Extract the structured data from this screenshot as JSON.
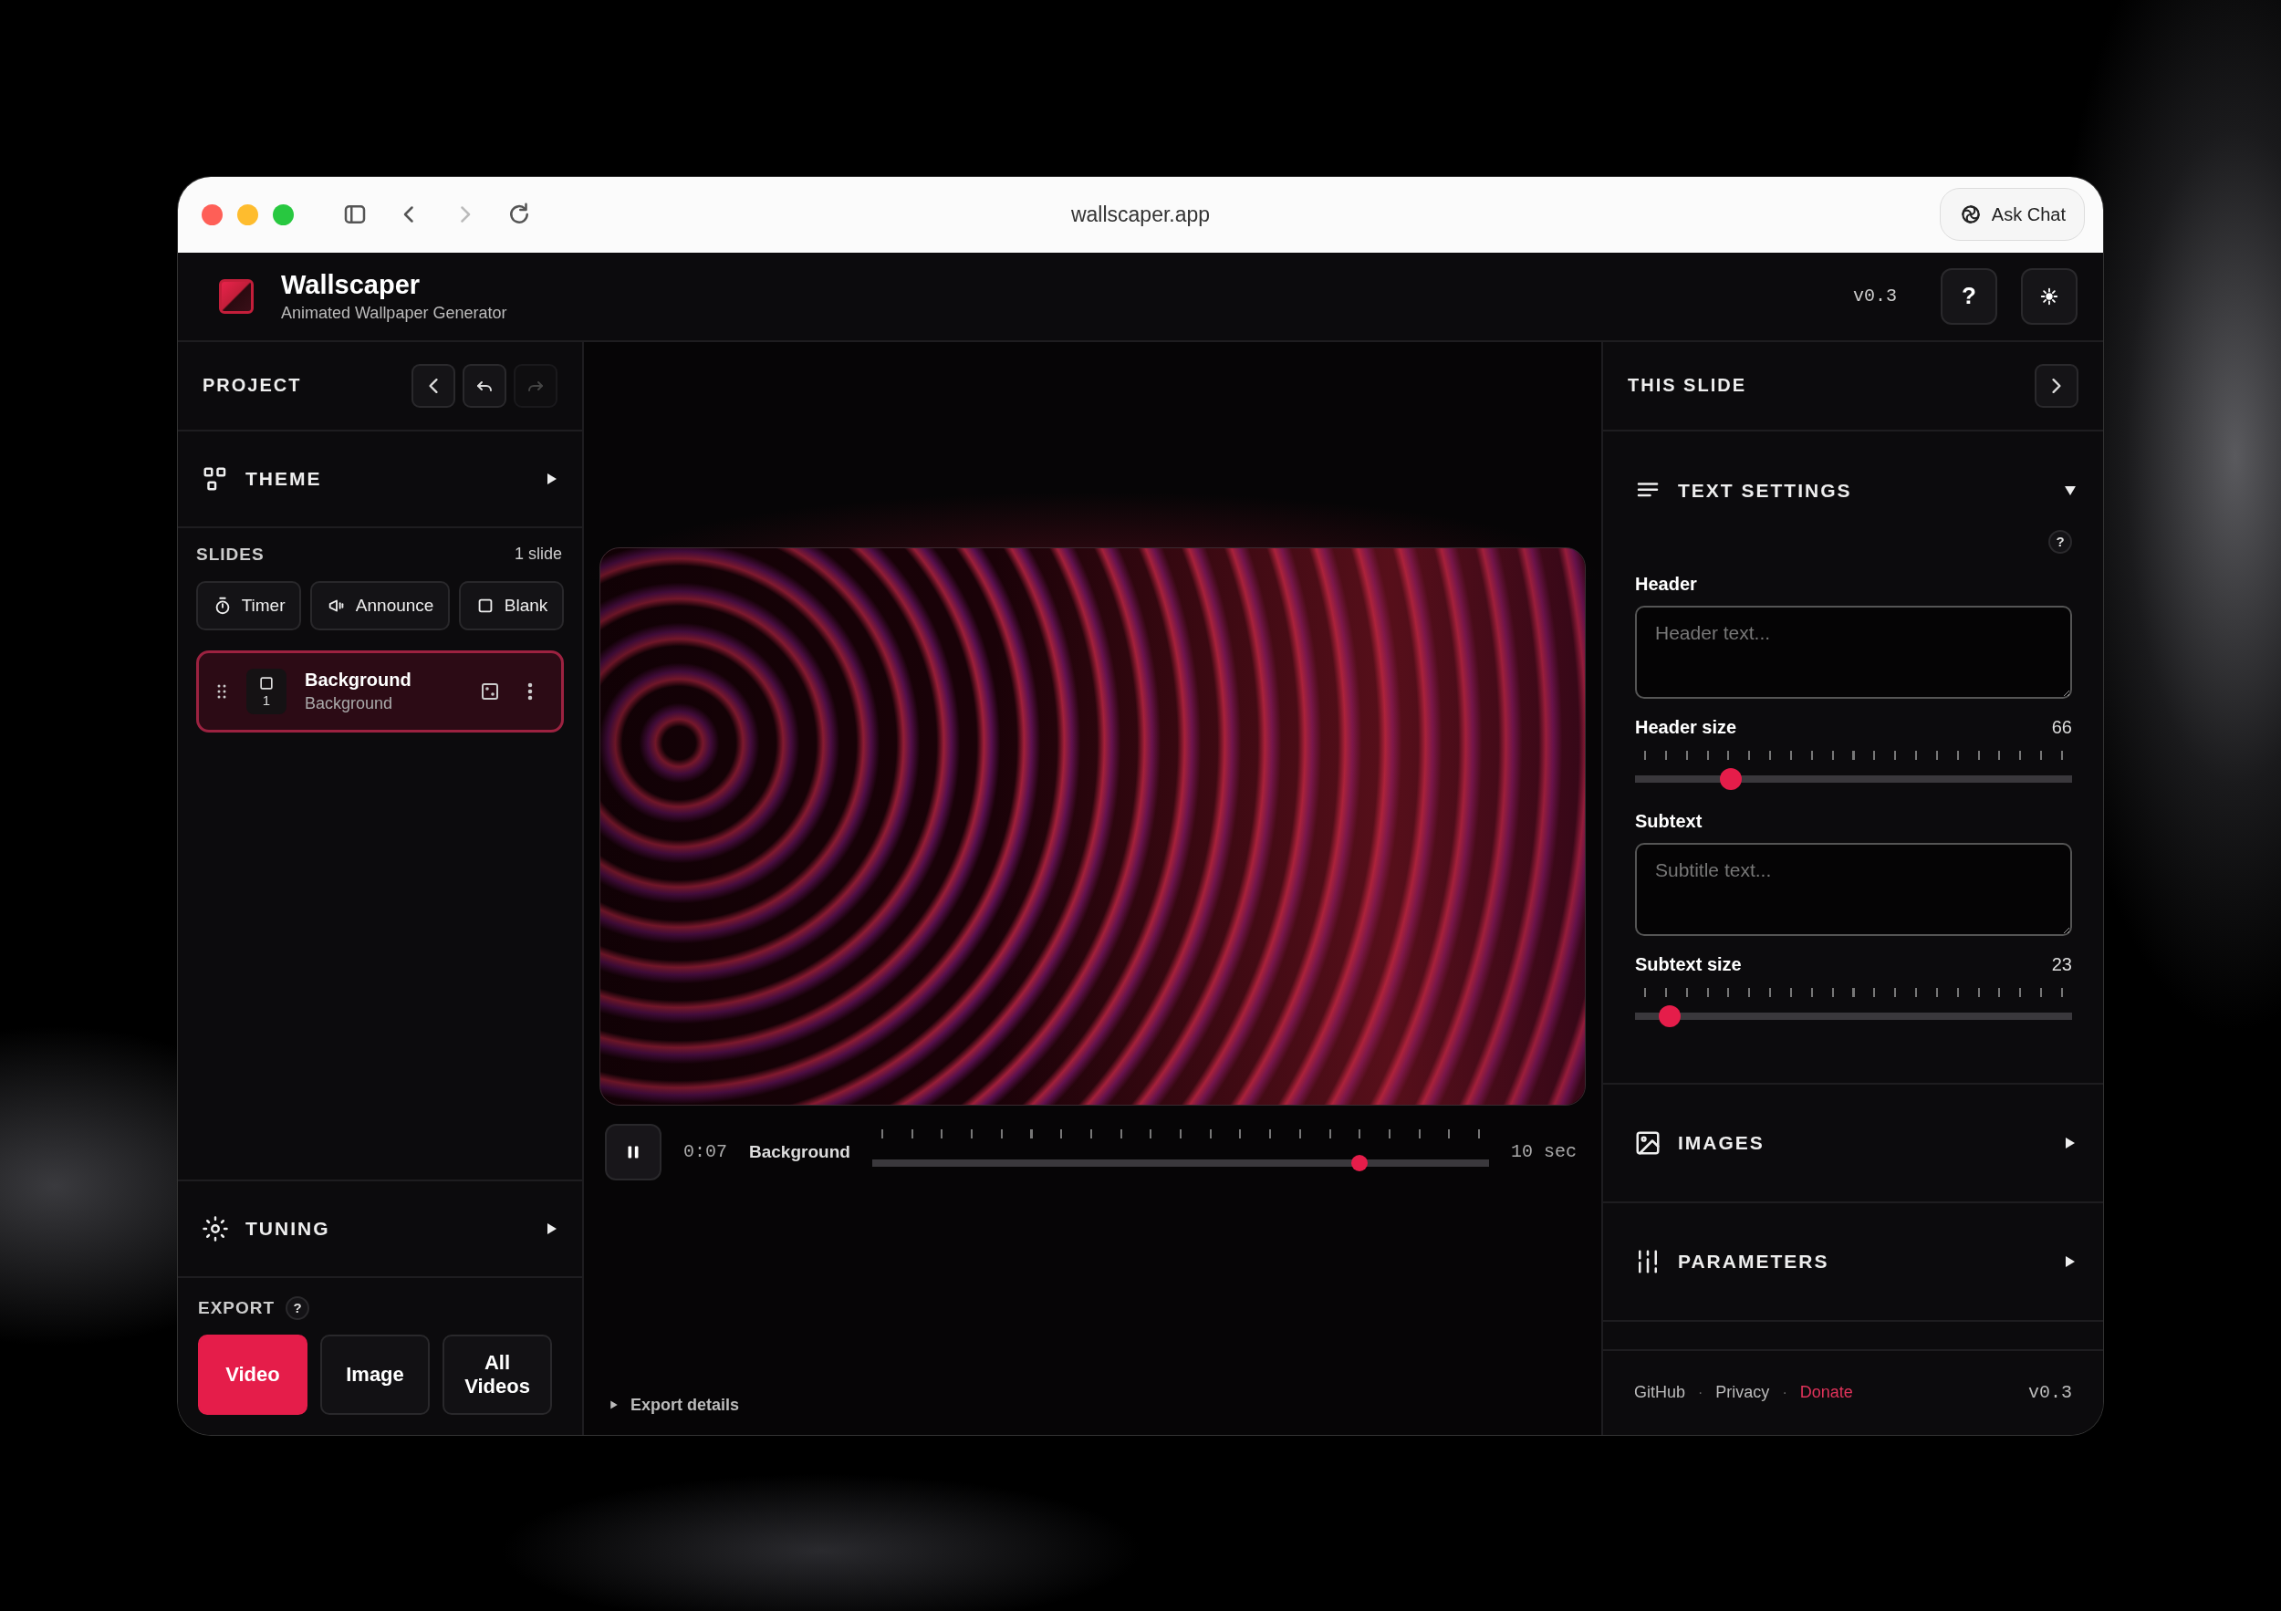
{
  "browser": {
    "url": "wallscaper.app",
    "ask_chat": "Ask Chat"
  },
  "app": {
    "title": "Wallscaper",
    "subtitle": "Animated Wallpaper Generator",
    "version": "v0.3",
    "help": "?"
  },
  "left_panel": {
    "title": "PROJECT",
    "nav_buttons": [
      {
        "kind": "back",
        "disabled": false
      },
      {
        "kind": "undo",
        "disabled": false
      },
      {
        "kind": "redo",
        "disabled": true
      }
    ],
    "theme": {
      "label": "THEME",
      "expanded": false
    },
    "slides": {
      "title": "SLIDES",
      "count": "1 slide",
      "add_buttons": [
        {
          "label": "Timer",
          "kind": "timer"
        },
        {
          "label": "Announce",
          "kind": "announce"
        },
        {
          "label": "Blank",
          "kind": "blank"
        }
      ],
      "items": [
        {
          "number": "1",
          "title": "Background",
          "subtitle": "Background",
          "selected": true
        }
      ]
    },
    "tuning": {
      "label": "TUNING",
      "expanded": false
    },
    "export": {
      "title": "EXPORT",
      "help": "?",
      "buttons": [
        {
          "label": "Video",
          "selected": true
        },
        {
          "label": "Image",
          "selected": false
        },
        {
          "label": "All Videos",
          "selected": false
        }
      ]
    }
  },
  "player": {
    "playing": true,
    "time": "0:07",
    "slide": "Background",
    "level": 0.79,
    "duration": "10 sec",
    "export_details": "Export details"
  },
  "right_panel": {
    "title": "THIS SLIDE",
    "sections": [
      {
        "kind": "text",
        "label": "TEXT SETTINGS",
        "expanded": true,
        "help": "?",
        "fields": [
          {
            "kind": "textarea",
            "label": "Header",
            "placeholder": "Header text..."
          },
          {
            "kind": "slider",
            "label": "Header size",
            "reading": "66",
            "level": 0.22
          },
          {
            "kind": "textarea",
            "label": "Subtext",
            "placeholder": "Subtitle text..."
          },
          {
            "kind": "slider",
            "label": "Subtext size",
            "reading": "23",
            "level": 0.08
          }
        ]
      },
      {
        "kind": "images",
        "label": "IMAGES",
        "expanded": false
      },
      {
        "kind": "parameters",
        "label": "PARAMETERS",
        "expanded": false
      }
    ],
    "footer": {
      "separator": "·",
      "links": [
        {
          "label": "GitHub",
          "highlight": false
        },
        {
          "label": "Privacy",
          "highlight": false
        },
        {
          "label": "Donate",
          "highlight": true
        }
      ],
      "version": "v0.3"
    }
  }
}
